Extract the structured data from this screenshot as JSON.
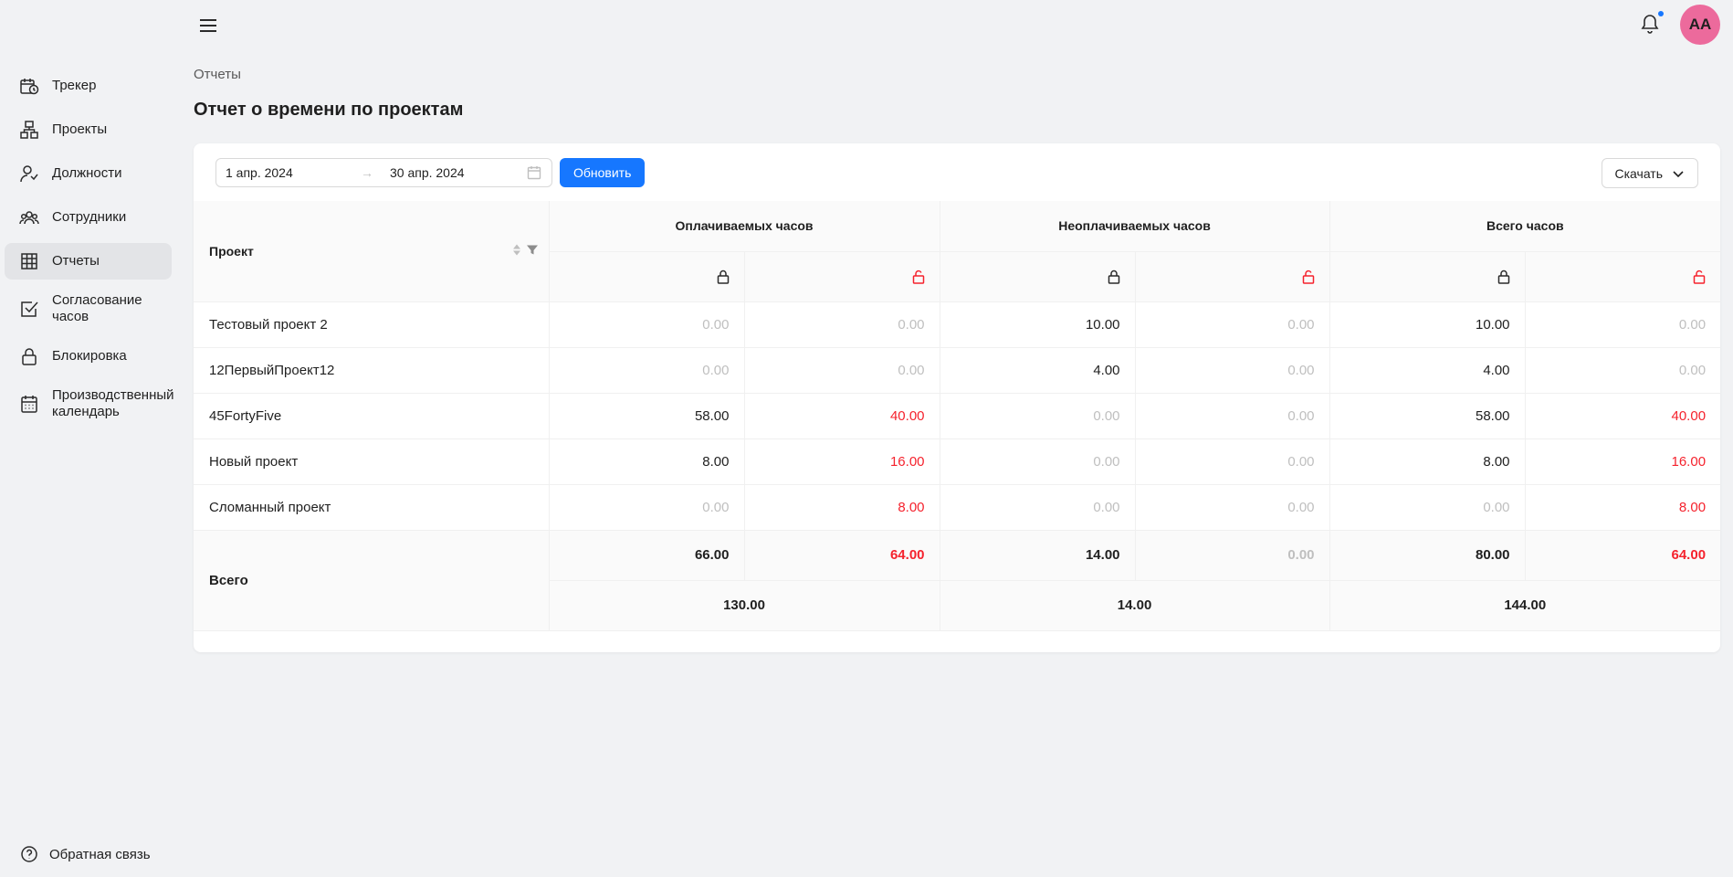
{
  "sidebar": {
    "items": [
      {
        "label": "Трекер",
        "icon": "tracker-icon"
      },
      {
        "label": "Проекты",
        "icon": "projects-icon"
      },
      {
        "label": "Должности",
        "icon": "positions-icon"
      },
      {
        "label": "Сотрудники",
        "icon": "employees-icon"
      },
      {
        "label": "Отчеты",
        "icon": "reports-icon",
        "active": true
      },
      {
        "label": "Согласование часов",
        "icon": "approval-icon"
      },
      {
        "label": "Блокировка",
        "icon": "lock-icon"
      },
      {
        "label": "Производственный календарь",
        "icon": "calendar-icon"
      }
    ],
    "feedback_label": "Обратная связь"
  },
  "header": {
    "avatar_initials": "AA",
    "has_notifications": true
  },
  "breadcrumb": "Отчеты",
  "page_title": "Отчет о времени по проектам",
  "filters": {
    "date_from": "1 апр. 2024",
    "date_to": "30 апр. 2024",
    "separator": "→",
    "refresh_label": "Обновить",
    "download_label": "Скачать"
  },
  "table": {
    "project_header": "Проект",
    "groups": [
      "Оплачиваемых часов",
      "Неоплачиваемых часов",
      "Всего часов"
    ],
    "rows": [
      {
        "name": "Тестовый проект 2",
        "values": [
          "0.00",
          "0.00",
          "10.00",
          "0.00",
          "10.00",
          "0.00"
        ],
        "styles": [
          "zero",
          "zero",
          "dark",
          "zero",
          "dark",
          "zero"
        ]
      },
      {
        "name": "12ПервыйПроект12",
        "values": [
          "0.00",
          "0.00",
          "4.00",
          "0.00",
          "4.00",
          "0.00"
        ],
        "styles": [
          "zero",
          "zero",
          "dark",
          "zero",
          "dark",
          "zero"
        ]
      },
      {
        "name": "45FortyFive",
        "values": [
          "58.00",
          "40.00",
          "0.00",
          "0.00",
          "58.00",
          "40.00"
        ],
        "styles": [
          "dark",
          "red",
          "zero",
          "zero",
          "dark",
          "red"
        ]
      },
      {
        "name": "Новый проект",
        "values": [
          "8.00",
          "16.00",
          "0.00",
          "0.00",
          "8.00",
          "16.00"
        ],
        "styles": [
          "dark",
          "red",
          "zero",
          "zero",
          "dark",
          "red"
        ]
      },
      {
        "name": "Сломанный проект",
        "values": [
          "0.00",
          "8.00",
          "0.00",
          "0.00",
          "0.00",
          "8.00"
        ],
        "styles": [
          "zero",
          "red",
          "zero",
          "zero",
          "zero",
          "red"
        ]
      }
    ],
    "total_label": "Всего",
    "totals": [
      "66.00",
      "64.00",
      "14.00",
      "0.00",
      "80.00",
      "64.00"
    ],
    "total_styles": [
      "dark",
      "red",
      "dark",
      "zero",
      "dark",
      "red"
    ],
    "group_totals": [
      "130.00",
      "14.00",
      "144.00"
    ]
  },
  "colors": {
    "accent": "#1677ff",
    "unlocked": "#f5222d",
    "avatar": "#ec6a9c",
    "zero_value": "#bfbfbf"
  }
}
